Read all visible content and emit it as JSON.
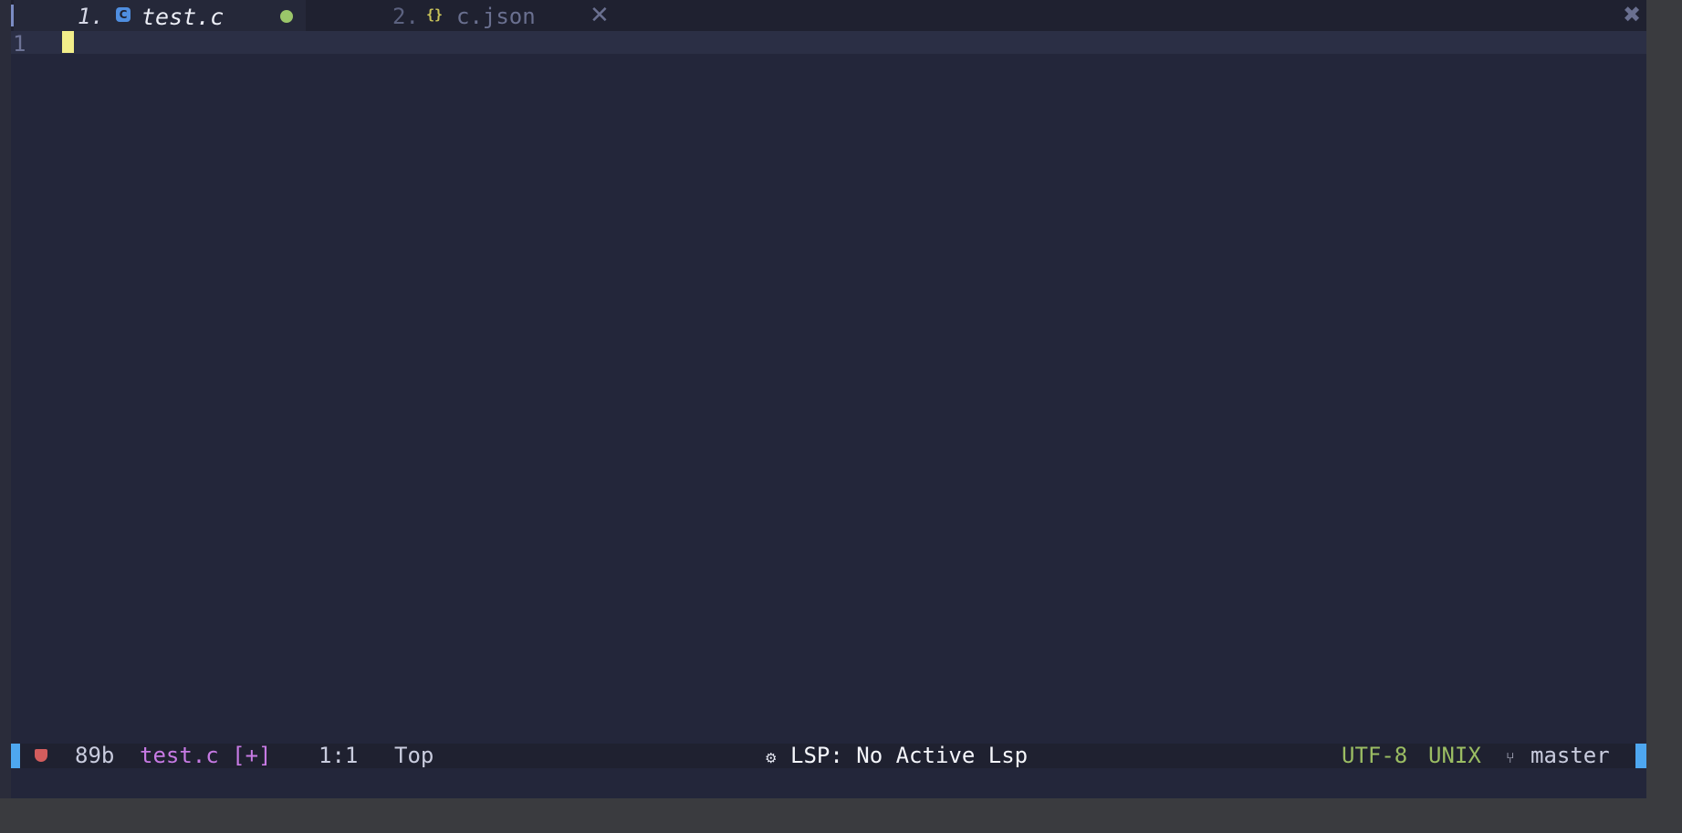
{
  "tabs": [
    {
      "index": "1.",
      "icon": "c-file-icon",
      "label": "test.c",
      "modified": true,
      "active": true
    },
    {
      "index": "2.",
      "icon": "json-file-icon",
      "label": "c.json",
      "close": "✕",
      "active": false
    }
  ],
  "tabbar": {
    "close_all": "✖"
  },
  "editor": {
    "line_number": "1"
  },
  "statusline": {
    "size": "89b",
    "filename": "test.c [+]",
    "position": "1:1",
    "scroll": "Top",
    "lsp_icon": "gear-network-icon",
    "lsp": "LSP: No Active Lsp",
    "encoding": "UTF-8",
    "format": "UNIX",
    "branch_icon": "git-branch-icon",
    "branch": "master"
  },
  "colors": {
    "editor_bg": "#23263a",
    "tabbar_bg": "#1f2130",
    "accent_blue": "#4ea7f0",
    "filename_purple": "#c77ae4",
    "encoding_green": "#9bbd63",
    "cursor_yellow": "#f2ee8a",
    "modified_dot": "#9bc66a"
  }
}
